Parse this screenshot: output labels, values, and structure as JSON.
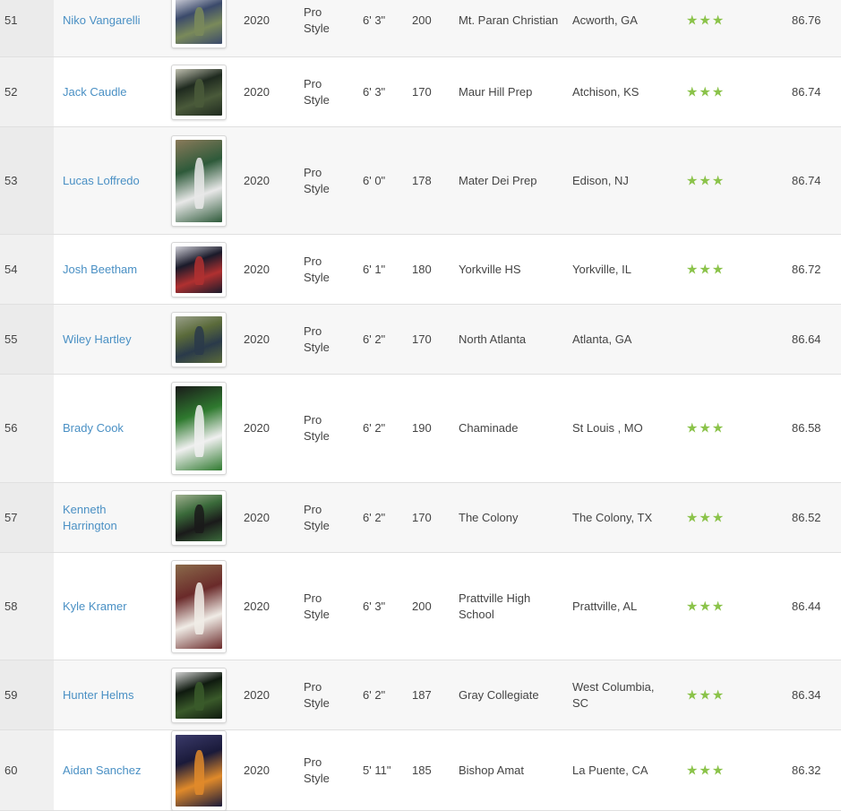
{
  "rows": [
    {
      "rank": "51",
      "name": "Niko Vangarelli",
      "year": "2020",
      "position": "Pro Style",
      "height": "6' 3\"",
      "weight": "200",
      "school": "Mt. Paran Christian",
      "location": "Acworth, GA",
      "stars": 3,
      "rating": "86.76",
      "photo_colors": [
        "#3b4a6b",
        "#7a8a5a",
        "#d8d8e0"
      ]
    },
    {
      "rank": "52",
      "name": "Jack Caudle",
      "year": "2020",
      "position": "Pro Style",
      "height": "6' 3\"",
      "weight": "170",
      "school": "Maur Hill Prep",
      "location": "Atchison, KS",
      "stars": 3,
      "rating": "86.74",
      "photo_colors": [
        "#1f2a1f",
        "#4a5a3a",
        "#c0c0b0"
      ]
    },
    {
      "rank": "53",
      "name": "Lucas Loffredo",
      "year": "2020",
      "position": "Pro Style",
      "height": "6' 0\"",
      "weight": "178",
      "school": "Mater Dei Prep",
      "location": "Edison, NJ",
      "stars": 3,
      "rating": "86.74",
      "photo_colors": [
        "#2e5a3a",
        "#e8e8e8",
        "#8a7a5a"
      ]
    },
    {
      "rank": "54",
      "name": "Josh Beetham",
      "year": "2020",
      "position": "Pro Style",
      "height": "6' 1\"",
      "weight": "180",
      "school": "Yorkville HS",
      "location": "Yorkville, IL",
      "stars": 3,
      "rating": "86.72",
      "photo_colors": [
        "#1a1a2a",
        "#b03030",
        "#d0d0d8"
      ]
    },
    {
      "rank": "55",
      "name": "Wiley Hartley",
      "year": "2020",
      "position": "Pro Style",
      "height": "6' 2\"",
      "weight": "170",
      "school": "North Atlanta",
      "location": "Atlanta, GA",
      "stars": 0,
      "rating": "86.64",
      "photo_colors": [
        "#5a6a3a",
        "#2a3a4a",
        "#9aa08a"
      ]
    },
    {
      "rank": "56",
      "name": "Brady Cook",
      "year": "2020",
      "position": "Pro Style",
      "height": "6' 2\"",
      "weight": "190",
      "school": "Chaminade",
      "location": "St Louis , MO",
      "stars": 3,
      "rating": "86.58",
      "photo_colors": [
        "#2f7a2f",
        "#f0f0f0",
        "#1a1a1a"
      ]
    },
    {
      "rank": "57",
      "name": "Kenneth Harrington",
      "year": "2020",
      "position": "Pro Style",
      "height": "6' 2\"",
      "weight": "170",
      "school": "The Colony",
      "location": "The Colony, TX",
      "stars": 3,
      "rating": "86.52",
      "photo_colors": [
        "#3a6a3a",
        "#1a1a1a",
        "#a0b090"
      ]
    },
    {
      "rank": "58",
      "name": "Kyle Kramer",
      "year": "2020",
      "position": "Pro Style",
      "height": "6' 3\"",
      "weight": "200",
      "school": "Prattville High School",
      "location": "Prattville, AL",
      "stars": 3,
      "rating": "86.44",
      "photo_colors": [
        "#6a2a2a",
        "#f0ece6",
        "#8a6a4a"
      ]
    },
    {
      "rank": "59",
      "name": "Hunter Helms",
      "year": "2020",
      "position": "Pro Style",
      "height": "6' 2\"",
      "weight": "187",
      "school": "Gray Collegiate",
      "location": "West Columbia, SC",
      "stars": 3,
      "rating": "86.34",
      "photo_colors": [
        "#0f1a0f",
        "#3a5a2a",
        "#d0d0d0"
      ]
    },
    {
      "rank": "60",
      "name": "Aidan Sanchez",
      "year": "2020",
      "position": "Pro Style",
      "height": "5' 11\"",
      "weight": "185",
      "school": "Bishop Amat",
      "location": "La Puente, CA",
      "stars": 3,
      "rating": "86.32",
      "photo_colors": [
        "#1a1a3a",
        "#e08a2a",
        "#3a3a6a"
      ]
    }
  ],
  "star_glyph": "★"
}
